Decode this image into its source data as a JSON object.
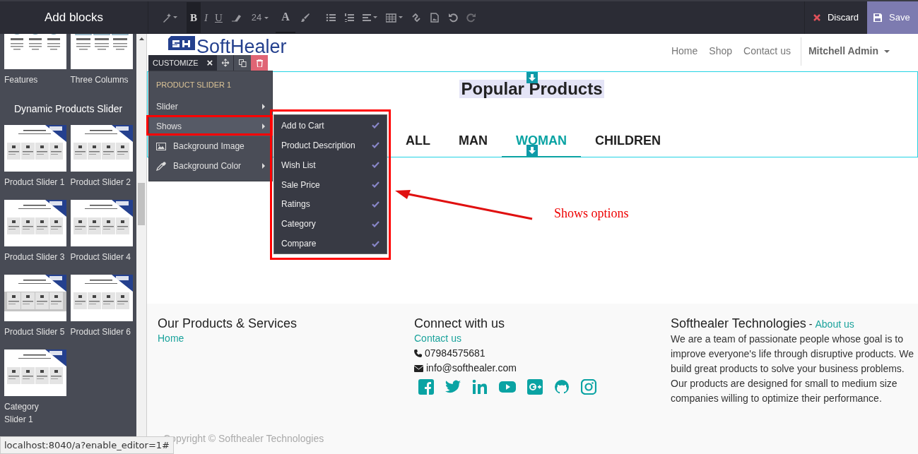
{
  "sidebar": {
    "title": "Add blocks",
    "top_blocks": [
      {
        "label": "Features",
        "kind": "features"
      },
      {
        "label": "Three Columns",
        "kind": "columns"
      }
    ],
    "section_title": "Dynamic Products Slider",
    "blocks": [
      {
        "label": "Product Slider 1",
        "kind": "slider"
      },
      {
        "label": "Product Slider 2",
        "kind": "slider"
      },
      {
        "label": "Product Slider 3",
        "kind": "slider"
      },
      {
        "label": "Product Slider 4",
        "kind": "slider"
      },
      {
        "label": "Product Slider 5",
        "kind": "band"
      },
      {
        "label": "Product Slider 6",
        "kind": "slider"
      },
      {
        "label": "Category Slider 1",
        "kind": "slider"
      }
    ]
  },
  "toolbar": {
    "format_buttons": [
      {
        "label": "B",
        "selected": true
      },
      {
        "label": "I",
        "selected": false
      },
      {
        "label": "U",
        "selected": false
      }
    ],
    "font_size": "24",
    "text_color": "A",
    "discard": "Discard",
    "save": "Save"
  },
  "site": {
    "logo": "SoftHealer",
    "nav": [
      "Home",
      "Shop",
      "Contact us"
    ],
    "user": "Mitchell Admin"
  },
  "snippet": {
    "title": "Popular Products",
    "tabs": [
      {
        "label": "ALL",
        "selected": false
      },
      {
        "label": "MAN",
        "selected": false
      },
      {
        "label": "WOMAN",
        "selected": true
      },
      {
        "label": "CHILDREN",
        "selected": false
      }
    ]
  },
  "customize": {
    "label": "CUSTOMIZE",
    "close": "×",
    "menu": [
      {
        "kind": "header",
        "label": "PRODUCT SLIDER 1"
      },
      {
        "kind": "submenu",
        "label": "Slider",
        "selected": false
      },
      {
        "kind": "submenu",
        "label": "Shows",
        "selected": true
      },
      {
        "kind": "image",
        "label": "Background Image"
      },
      {
        "kind": "color",
        "label": "Background Color"
      }
    ],
    "shows_options": [
      {
        "label": "Add to Cart",
        "checked": true
      },
      {
        "label": "Product Description",
        "checked": true
      },
      {
        "label": "Wish List",
        "checked": true
      },
      {
        "label": "Sale Price",
        "checked": true
      },
      {
        "label": "Ratings",
        "checked": true
      },
      {
        "label": "Category",
        "checked": true
      },
      {
        "label": "Compare",
        "checked": true
      }
    ]
  },
  "annotation": "Shows options",
  "footer": {
    "col1": {
      "title": "Our Products & Services",
      "links": [
        "Home"
      ]
    },
    "col2": {
      "title": "Connect with us",
      "link": "Contact us",
      "phone": "07984575681",
      "email": "info@softhealer.com"
    },
    "col3": {
      "title": "Softhealer Technologies",
      "separator": "-",
      "link": "About us",
      "paragraphs": [
        "We are a team of passionate people whose goal is to improve everyone's life through disruptive products. We build great products to solve your business problems.",
        "Our products are designed for small to medium size companies willing to optimize their performance."
      ]
    },
    "copyright": "Copyright © Softhealer Technologies"
  },
  "status_bar": "localhost:8040/a?enable_editor=1#"
}
